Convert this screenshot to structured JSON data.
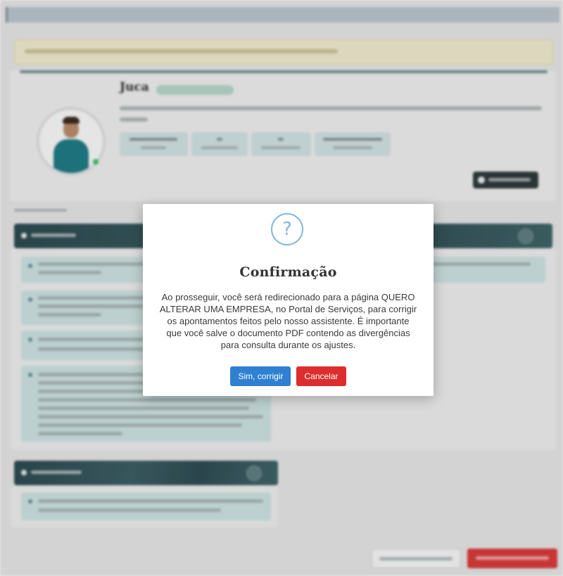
{
  "profile": {
    "name": "Juca"
  },
  "modal": {
    "icon": "question-mark-icon",
    "icon_glyph": "?",
    "title": "Confirmação",
    "message": "Ao prosseguir, você será redirecionado para a página QUERO ALTERAR UMA EMPRESA, no Portal de Serviços, para corrigir os apontamentos feitos pelo nosso assistente. É importante que você salve o documento PDF contendo as divergências para consulta durante os ajustes.",
    "confirm_label": "Sim, corrigir",
    "cancel_label": "Cancelar"
  },
  "colors": {
    "confirm": "#2f80d1",
    "cancel": "#dc2e2e",
    "section_header": "#2c4a50",
    "item_background": "#cbe0df",
    "alert_background": "#eee8cc",
    "icon_accent": "#86b7db"
  }
}
